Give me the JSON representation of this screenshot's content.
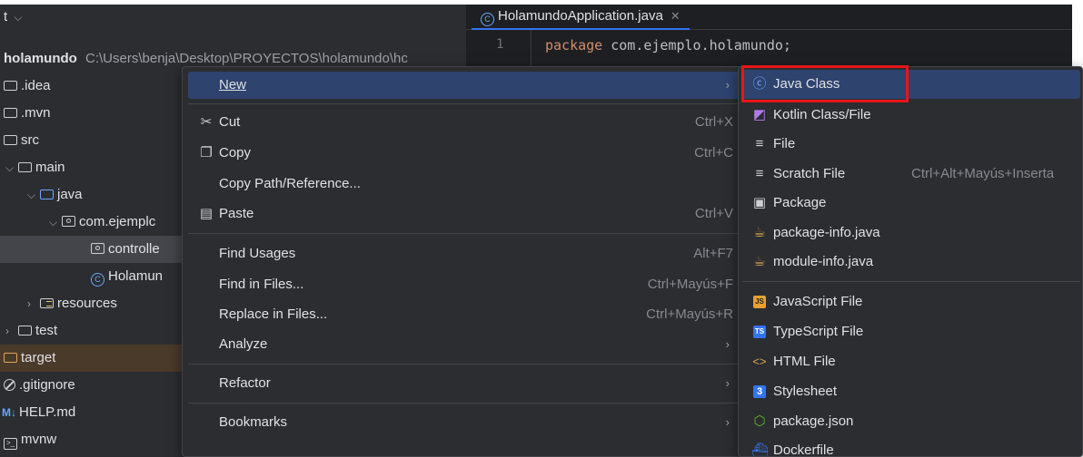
{
  "project": {
    "header_label": "t",
    "root_name": "holamundo",
    "root_path": "C:\\Users\\benja\\Desktop\\PROYECTOS\\holamundo\\hc",
    "tree": [
      {
        "label": ".idea"
      },
      {
        "label": ".mvn"
      },
      {
        "label": "src"
      },
      {
        "label": "main"
      },
      {
        "label": "java"
      },
      {
        "label": "com.ejemplc"
      },
      {
        "label": "controlle"
      },
      {
        "label": "Holamun"
      },
      {
        "label": "resources"
      },
      {
        "label": "test"
      },
      {
        "label": "target"
      },
      {
        "label": ".gitignore"
      },
      {
        "label": "HELP.md"
      },
      {
        "label": "mvnw"
      }
    ]
  },
  "editor": {
    "tab_label": "HolamundoApplication.java",
    "line_number": "1",
    "code_keyword": "package",
    "code_rest": " com.ejemplo.holamundo;"
  },
  "context_menu": {
    "new": "New",
    "cut": "Cut",
    "cut_shortcut": "Ctrl+X",
    "copy": "Copy",
    "copy_shortcut": "Ctrl+C",
    "copy_path": "Copy Path/Reference...",
    "paste": "Paste",
    "paste_shortcut": "Ctrl+V",
    "find_usages": "Find Usages",
    "find_usages_shortcut": "Alt+F7",
    "find_in_files": "Find in Files...",
    "find_in_files_shortcut": "Ctrl+Mayús+F",
    "replace_in_files": "Replace in Files...",
    "replace_in_files_shortcut": "Ctrl+Mayús+R",
    "analyze": "Analyze",
    "refactor": "Refactor",
    "bookmarks": "Bookmarks"
  },
  "submenu": {
    "java_class": "Java Class",
    "kotlin": "Kotlin Class/File",
    "file": "File",
    "scratch": "Scratch File",
    "scratch_shortcut": "Ctrl+Alt+Mayús+Inserta",
    "package": "Package",
    "package_info": "package-info.java",
    "module_info": "module-info.java",
    "javascript": "JavaScript File",
    "typescript": "TypeScript File",
    "html": "HTML File",
    "stylesheet": "Stylesheet",
    "package_json": "package.json",
    "dockerfile": "Dockerfile"
  },
  "colors": {
    "highlight_box": "#e8151a",
    "menu_active": "#2e436e",
    "panel_bg": "#2b2d30",
    "editor_bg": "#1e1f22"
  }
}
